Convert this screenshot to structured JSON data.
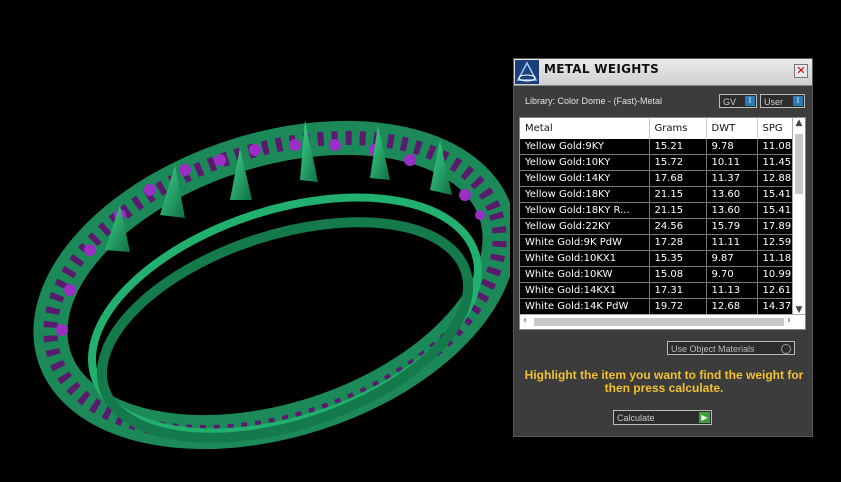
{
  "panel": {
    "title": "METAL WEIGHTS",
    "close_label": "✕",
    "library_label": "Library: Color Dome - (Fast)-Metal",
    "unit_selector": {
      "value": "GV",
      "button": "I"
    },
    "user_selector": {
      "value": "User",
      "button": "I"
    },
    "table": {
      "columns": [
        "Metal",
        "Grams",
        "DWT",
        "SPG"
      ],
      "rows": [
        [
          "Yellow Gold:9KY",
          "15.21",
          "9.78",
          "11.08"
        ],
        [
          "Yellow Gold:10KY",
          "15.72",
          "10.11",
          "11.45"
        ],
        [
          "Yellow Gold:14KY",
          "17.68",
          "11.37",
          "12.88"
        ],
        [
          "Yellow Gold:18KY",
          "21.15",
          "13.60",
          "15.41"
        ],
        [
          "Yellow Gold:18KY R...",
          "21.15",
          "13.60",
          "15.41"
        ],
        [
          "Yellow Gold:22KY",
          "24.56",
          "15.79",
          "17.89"
        ],
        [
          "White Gold:9K PdW",
          "17.28",
          "11.11",
          "12.59"
        ],
        [
          "White Gold:10KX1",
          "15.35",
          "9.87",
          "11.18"
        ],
        [
          "White Gold:10KW",
          "15.08",
          "9.70",
          "10.99"
        ],
        [
          "White Gold:14KX1",
          "17.31",
          "11.13",
          "12.61"
        ],
        [
          "White Gold:14K PdW",
          "19.72",
          "12.68",
          "14.37"
        ]
      ]
    },
    "use_object_materials": "Use Object Materials",
    "instructions": "Highlight the item you want to find the weight for then press calculate.",
    "calculate_label": "Calculate",
    "calculate_button": "▶"
  },
  "viewport": {
    "object": "ring-bangle"
  }
}
